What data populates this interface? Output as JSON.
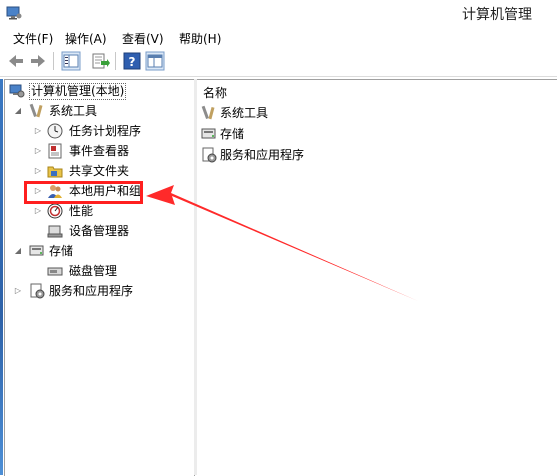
{
  "window": {
    "title": "计算机管理"
  },
  "menu": [
    "文件(F)",
    "操作(A)",
    "查看(V)",
    "帮助(H)"
  ],
  "toolbar": {
    "buttons": [
      "back-icon",
      "forward-icon",
      "show-hide-console-tree-icon",
      "export-list-icon",
      "help-icon",
      "properties-icon"
    ]
  },
  "tree": {
    "root": "计算机管理(本地)",
    "system_tools": "系统工具",
    "task_scheduler": "任务计划程序",
    "event_viewer": "事件查看器",
    "shared_folders": "共享文件夹",
    "local_users": "本地用户和组",
    "performance": "性能",
    "device_manager": "设备管理器",
    "storage": "存储",
    "disk_management": "磁盘管理",
    "services_apps": "服务和应用程序"
  },
  "list": {
    "header": "名称",
    "items": [
      "系统工具",
      "存储",
      "服务和应用程序"
    ]
  },
  "colors": {
    "annotation": "#ff1f1f"
  }
}
